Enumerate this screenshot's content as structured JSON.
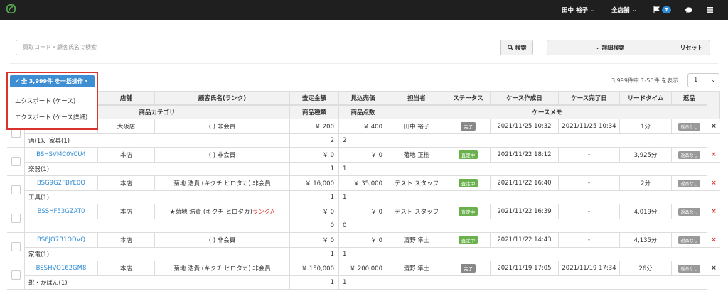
{
  "topbar": {
    "user_name": "田中 裕子",
    "store_menu": "全店舗",
    "flag_count": "7"
  },
  "search": {
    "placeholder": "買取コード・顧客氏名で検索",
    "search_label": "検索",
    "advanced_label": "詳細検索",
    "reset_label": "リセット"
  },
  "bulk": {
    "button_label": "全 3,999件 を一括操作",
    "export_case": "エクスポート (ケース)",
    "export_case_detail": "エクスポート (ケース詳細)"
  },
  "pager": {
    "summary": "3,999件中 1-50件 を表示",
    "page": "1"
  },
  "table": {
    "headers": [
      "店舗",
      "顧客氏名(ランク)",
      "査定金額",
      "見込売価",
      "担当者",
      "ステータス",
      "ケース作成日",
      "ケース完了日",
      "リードタイム",
      "返品"
    ],
    "subheaders": [
      "商品カテゴリ",
      "商品種類",
      "商品点数",
      "ケースメモ"
    ],
    "rows": [
      {
        "code": "",
        "store": "大阪店",
        "customer": "( ) 非会員",
        "rank": "",
        "amount": "￥ 200",
        "expected": "￥ 400",
        "staff": "田中 裕子",
        "status": "完了",
        "created": "2021/11/25 10:32",
        "completed": "2021/11/25 10:34",
        "lead": "1分",
        "returned": "返品なし",
        "category": "酒(1)、家具(1)",
        "kinds": "2",
        "kinds2": "2"
      },
      {
        "code": "BSHSVMC0YCU4",
        "store": "本店",
        "customer": "( ) 非会員",
        "rank": "",
        "amount": "￥ 0",
        "expected": "￥ 0",
        "staff": "菊地 正樹",
        "status": "査定中",
        "created": "2021/11/22 18:12",
        "completed": "-",
        "lead": "3,925分",
        "returned": "返品なし",
        "category": "楽器(1)",
        "kinds": "1",
        "kinds2": "1"
      },
      {
        "code": "BSG9G2FBYE0Q",
        "store": "本店",
        "customer": "菊地 浩貴 (キクチ ヒロタカ) 非会員",
        "rank": "",
        "amount": "￥ 16,000",
        "expected": "￥ 35,000",
        "staff": "テスト スタッフ",
        "status": "査定中",
        "created": "2021/11/22 16:40",
        "completed": "-",
        "lead": "2分",
        "returned": "返品なし",
        "category": "工具(1)",
        "kinds": "1",
        "kinds2": "1"
      },
      {
        "code": "BSSHF53GZAT0",
        "store": "本店",
        "customer": "★菊地 浩貴 (キクチ ヒロタカ) ",
        "rank": "ランクA",
        "amount": "￥ 0",
        "expected": "￥ 0",
        "staff": "テスト スタッフ",
        "status": "査定中",
        "created": "2021/11/22 16:39",
        "completed": "-",
        "lead": "4,019分",
        "returned": "返品なし",
        "category": "",
        "kinds": "0",
        "kinds2": "0"
      },
      {
        "code": "BS6JO7B1ODVQ",
        "store": "本店",
        "customer": "( ) 非会員",
        "rank": "",
        "amount": "￥ 0",
        "expected": "￥ 0",
        "staff": "清野 隼土",
        "status": "査定中",
        "created": "2021/11/22 14:43",
        "completed": "-",
        "lead": "4,135分",
        "returned": "返品なし",
        "category": "家電(1)",
        "kinds": "1",
        "kinds2": "1"
      },
      {
        "code": "BSSHVO162GM8",
        "store": "本店",
        "customer": "菊地 浩貴 (キクチ ヒロタカ) 非会員",
        "rank": "",
        "amount": "￥ 150,000",
        "expected": "￥ 200,000",
        "staff": "清野 隼土",
        "status": "完了",
        "created": "2021/11/19 17:05",
        "completed": "2021/11/19 17:34",
        "lead": "26分",
        "returned": "返品なし",
        "category": "靴・かばん(1)",
        "kinds": "1",
        "kinds2": "1"
      }
    ]
  },
  "colors": {
    "accent": "#3e8ed4",
    "pending": "#6ab04c",
    "done": "#888888",
    "delete_red": "#d9342b"
  }
}
